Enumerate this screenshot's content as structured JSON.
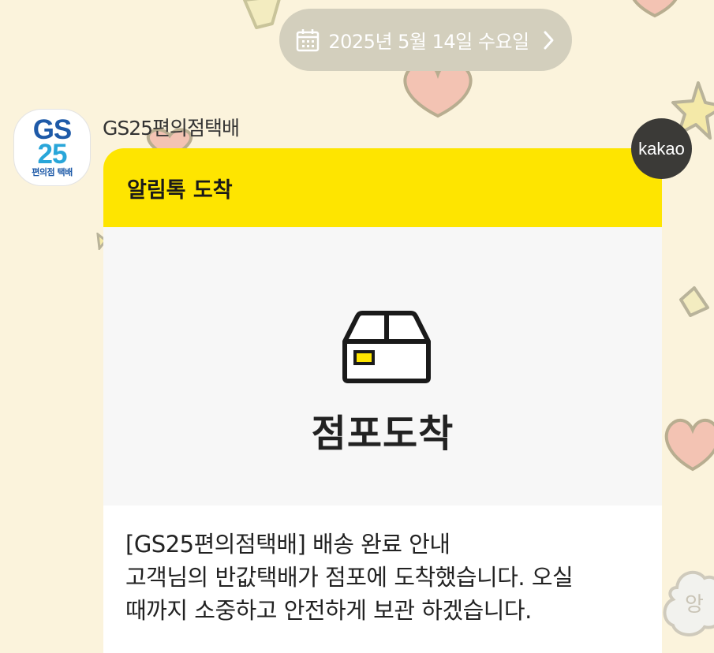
{
  "date_bar": {
    "text": "2025년 5월 14일 수요일",
    "icon": "calendar-icon",
    "chevron": "chevron-right-icon"
  },
  "sender": {
    "name": "GS25편의점택배",
    "avatar": {
      "line1": "GS",
      "line2": "25",
      "line3": "편의점 택배"
    }
  },
  "kakao_badge": "kakao",
  "card": {
    "header": "알림톡 도착",
    "hero_icon": "box-icon",
    "hero_title": "점포도착",
    "body_lines": [
      "[GS25편의점택배] 배송 완료 안내",
      "고객님의 반값택배가 점포에 도착했습니다. 오실",
      "때까지 소중하고 안전하게 보관 하겠습니다."
    ]
  },
  "colors": {
    "background": "#fbf3dc",
    "header_yellow": "#fee500",
    "date_pill": "#d3cfbd",
    "kakao_badge": "#3b3a37"
  }
}
